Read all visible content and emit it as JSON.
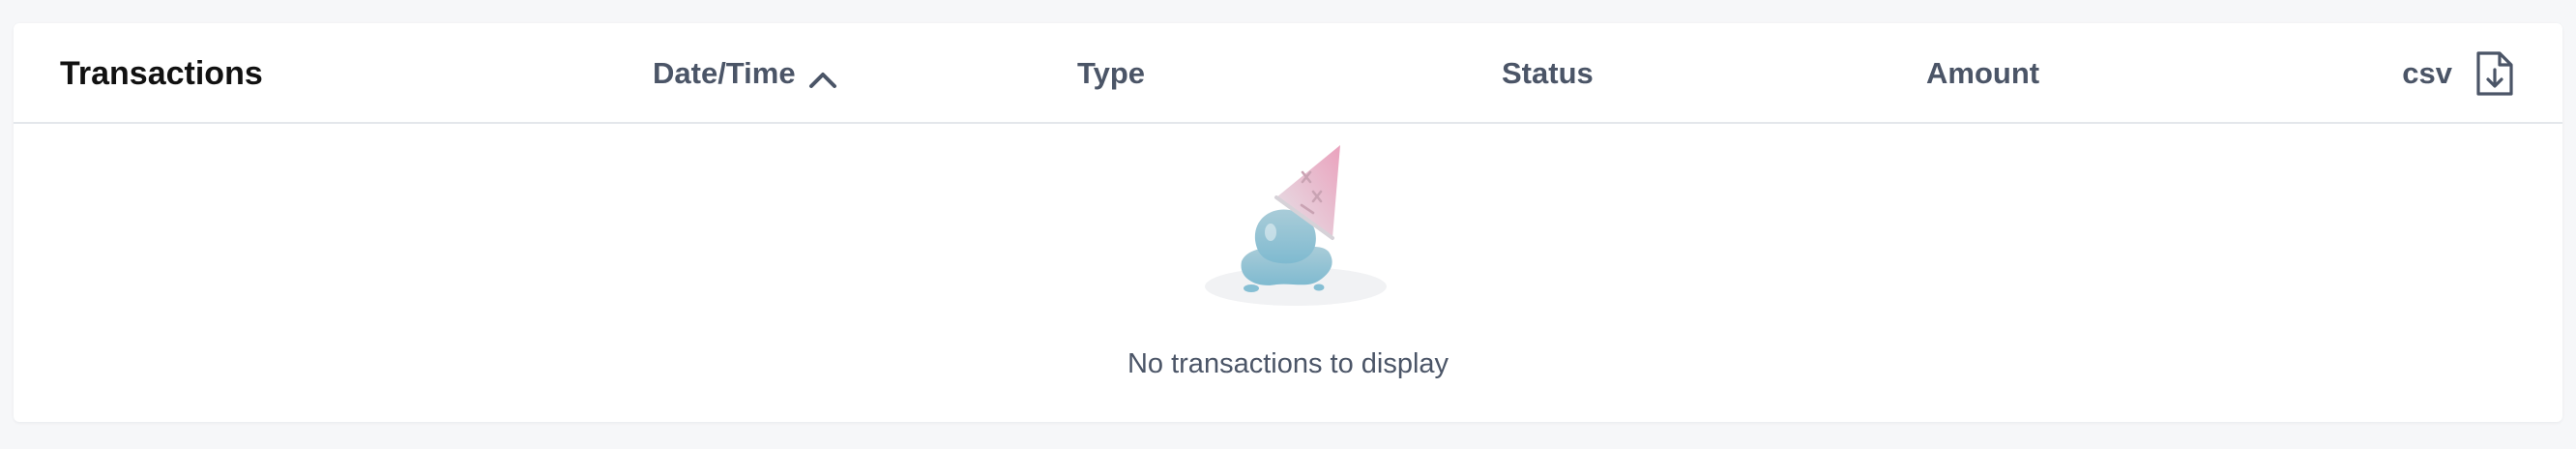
{
  "table": {
    "title": "Transactions",
    "columns": {
      "date_time": "Date/Time",
      "type": "Type",
      "status": "Status",
      "amount": "Amount"
    },
    "sort": {
      "column": "Date/Time",
      "direction": "ascending",
      "icon": "chevron-up-icon"
    },
    "export": {
      "label": "csv",
      "icon": "file-download-icon"
    },
    "empty_message": "No transactions to display",
    "empty_illustration": "melted-ice-cream-icon"
  },
  "colors": {
    "background": "#f6f7f9",
    "card": "#ffffff",
    "title_text": "#111111",
    "header_text": "#4b5567",
    "divider": "#e4e7eb",
    "ice_cream_cone": "#e8b4c6",
    "ice_cream_scoop": "#9cc6d4"
  }
}
